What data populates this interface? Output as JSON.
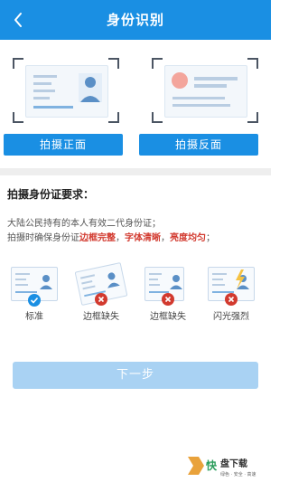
{
  "header": {
    "title": "身份识别",
    "back_icon": "chevron-left-icon",
    "color": "#1a8fe3"
  },
  "capture": {
    "front_button": "拍摄正面",
    "back_button": "拍摄反面"
  },
  "requirements": {
    "title": "拍摄身份证要求：",
    "line1": "大陆公民持有的本人有效二代身份证；",
    "line2_prefix": "拍摄时确保身份证",
    "hl1": "边框完整",
    "sep1": "，",
    "hl2": "字体清晰",
    "sep2": "，",
    "hl3": "亮度均匀",
    "line2_suffix": "；"
  },
  "examples": [
    {
      "label": "标准",
      "status_icon": "check-icon",
      "status_color": "#1a8fe3"
    },
    {
      "label": "边框缺失",
      "status_icon": "cross-icon",
      "status_color": "#d23a2f"
    },
    {
      "label": "边框缺失",
      "status_icon": "cross-icon",
      "status_color": "#d23a2f"
    },
    {
      "label": "闪光强烈",
      "status_icon": "cross-icon",
      "status_color": "#d23a2f"
    }
  ],
  "next_button": "下一步",
  "watermark": {
    "logo_text": "快",
    "title": "盘下载",
    "subtitle": "绿色 · 安全 · 高速"
  }
}
